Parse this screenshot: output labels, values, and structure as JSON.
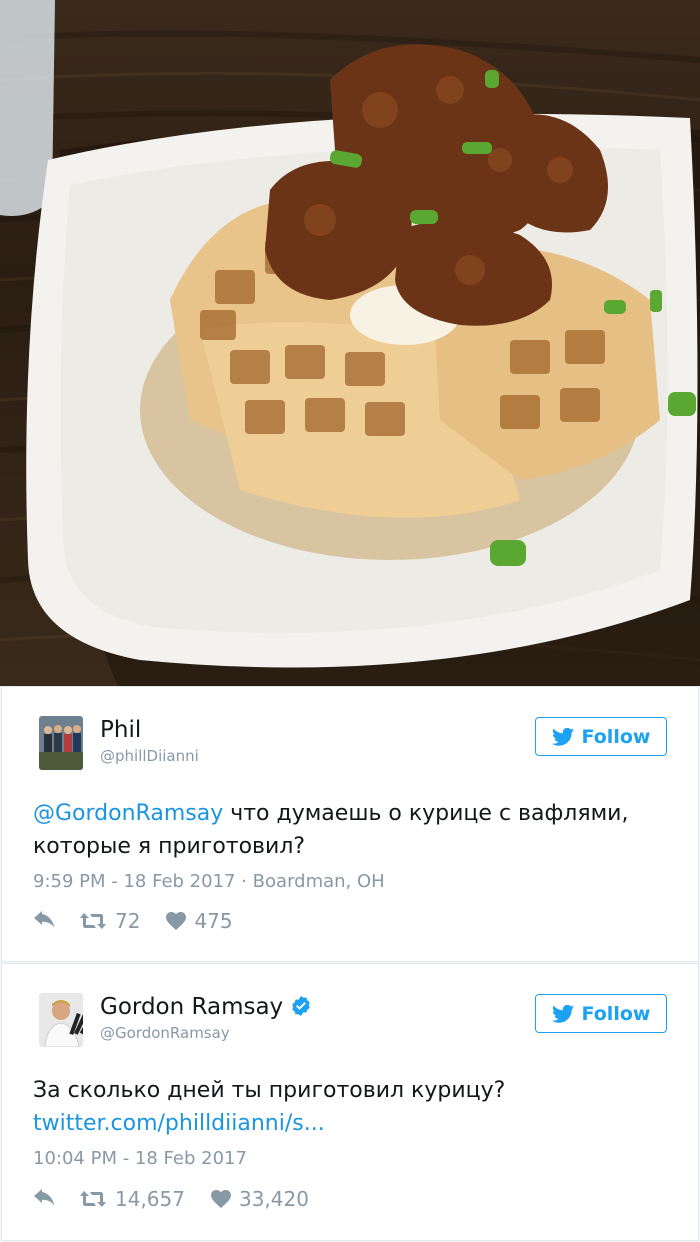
{
  "photo": {
    "icon": "chicken-and-waffles-photo"
  },
  "tweets": [
    {
      "name": "Phil",
      "handle": "@phillDiianni",
      "follow_label": "Follow",
      "mention": "@GordonRamsay",
      "text": " что думаешь о курице с вафлями, которые я приготовил?",
      "timestamp": "9:59 PM - 18 Feb 2017",
      "location_sep": " · ",
      "location": "Boardman, OH",
      "retweets": "72",
      "likes": "475"
    },
    {
      "name": "Gordon Ramsay",
      "handle": "@GordonRamsay",
      "follow_label": "Follow",
      "text": "За сколько дней ты приготовил курицу?",
      "link": "twitter.com/philldiianni/s...",
      "timestamp": "10:04 PM - 18 Feb 2017",
      "retweets": "14,657",
      "likes": "33,420"
    }
  ],
  "colors": {
    "accent": "#1da1f2",
    "link": "#1b95e0",
    "muted": "#8899a6"
  }
}
